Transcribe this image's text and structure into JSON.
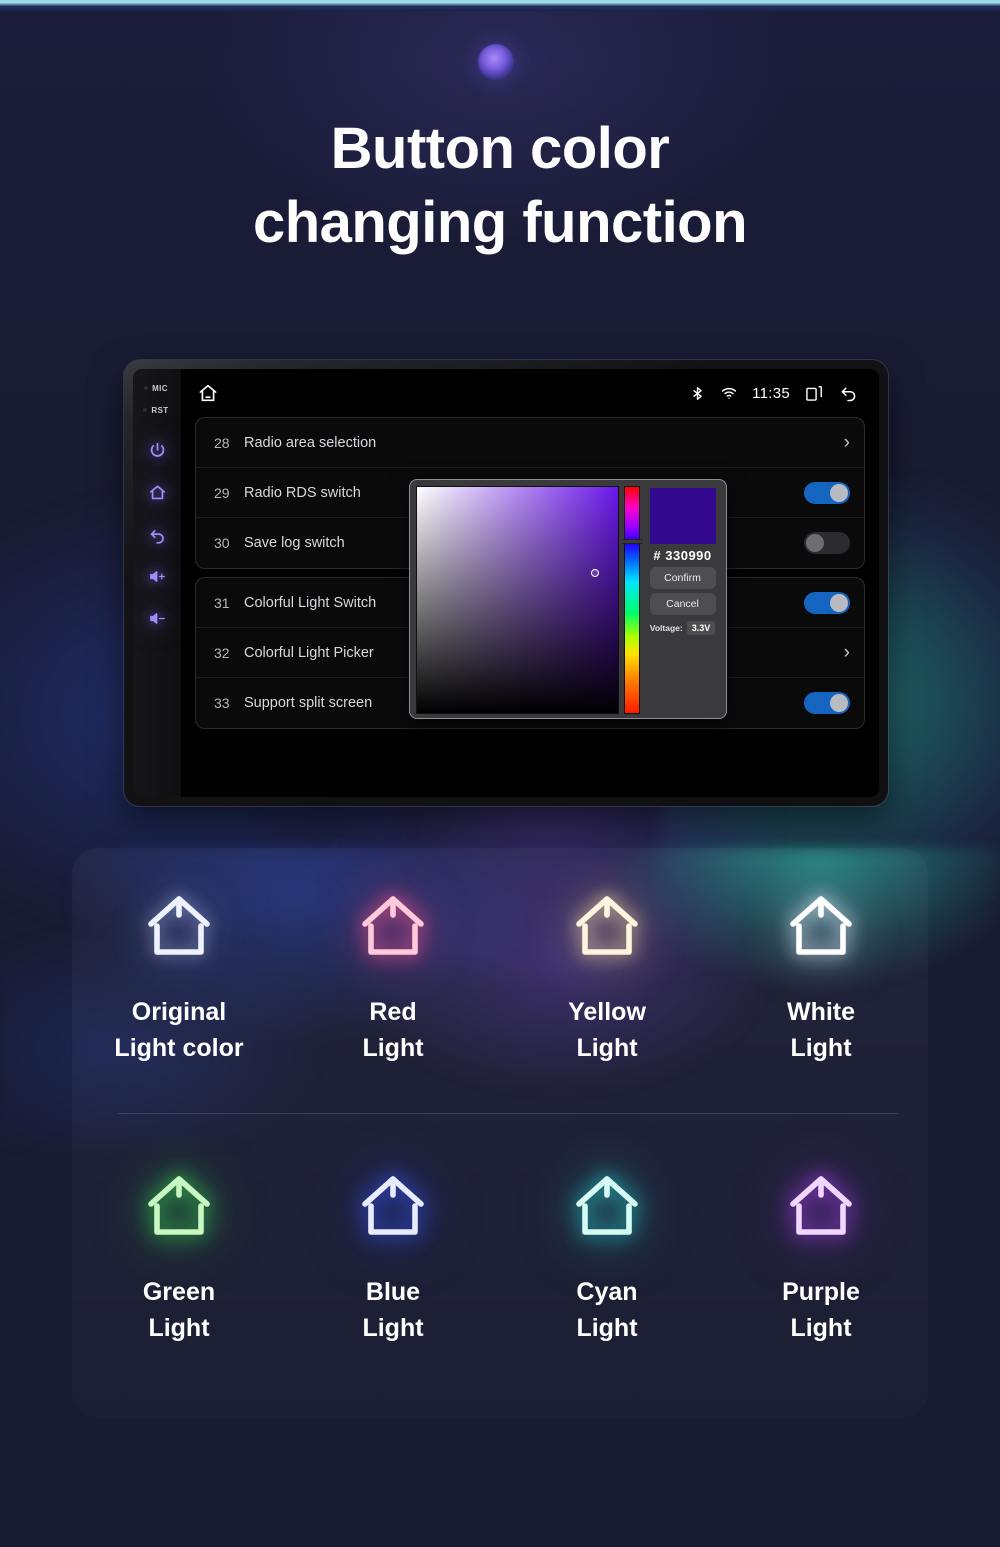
{
  "header": {
    "title_line1": "Button color",
    "title_line2": "changing function"
  },
  "device": {
    "rail": {
      "mic_label": "MIC",
      "rst_label": "RST",
      "buttons": [
        {
          "name": "power-icon"
        },
        {
          "name": "home-icon"
        },
        {
          "name": "back-icon"
        },
        {
          "name": "volume-up-icon"
        },
        {
          "name": "volume-down-icon"
        }
      ],
      "glow_color": "#a18cf5"
    },
    "statusbar": {
      "home_icon": "home-icon",
      "bluetooth_icon": "bluetooth-icon",
      "wifi_icon": "wifi-icon",
      "time": "11:35",
      "recents_icon": "recent-apps-icon",
      "back_icon": "back-icon"
    },
    "settings_groups": [
      {
        "rows": [
          {
            "num": "28",
            "label": "Radio area selection",
            "control": "chevron"
          },
          {
            "num": "29",
            "label": "Radio RDS switch",
            "control": "toggle",
            "state": "on"
          },
          {
            "num": "30",
            "label": "Save log switch",
            "control": "toggle",
            "state": "off"
          }
        ]
      },
      {
        "rows": [
          {
            "num": "31",
            "label": "Colorful Light Switch",
            "control": "toggle",
            "state": "on"
          },
          {
            "num": "32",
            "label": "Colorful Light Picker",
            "control": "chevron"
          },
          {
            "num": "33",
            "label": "Support split screen",
            "control": "toggle",
            "state": "on"
          }
        ]
      }
    ],
    "color_picker": {
      "hex_prefix": "#",
      "hex_value": "330990",
      "swatch_color": "#330990",
      "confirm_label": "Confirm",
      "cancel_label": "Cancel",
      "voltage_label": "Voltage:",
      "voltage_value": "3.3V"
    }
  },
  "lights": {
    "row1": [
      {
        "name": "original-light-color",
        "line1": "Original",
        "line2": "Light color",
        "color": "#eef2ff",
        "glow": "rgba(200,215,255,0.55)"
      },
      {
        "name": "red-light",
        "line1": "Red",
        "line2": "Light",
        "color": "#ffc9dc",
        "glow": "rgba(255,90,150,0.75)"
      },
      {
        "name": "yellow-light",
        "line1": "Yellow",
        "line2": "Light",
        "color": "#fff4dd",
        "glow": "rgba(255,225,170,0.75)"
      },
      {
        "name": "white-light",
        "line1": "White",
        "line2": "Light",
        "color": "#ffffff",
        "glow": "rgba(235,240,255,0.85)"
      }
    ],
    "row2": [
      {
        "name": "green-light",
        "line1": "Green",
        "line2": "Light",
        "color": "#c8f7c0",
        "glow": "rgba(60,235,90,0.85)"
      },
      {
        "name": "blue-light",
        "line1": "Blue",
        "line2": "Light",
        "color": "#e7ecff",
        "glow": "rgba(60,90,255,0.9)"
      },
      {
        "name": "cyan-light",
        "line1": "Cyan",
        "line2": "Light",
        "color": "#d6fbf4",
        "glow": "rgba(40,225,215,0.85)"
      },
      {
        "name": "purple-light",
        "line1": "Purple",
        "line2": "Light",
        "color": "#f0d7ff",
        "glow": "rgba(185,70,255,0.9)"
      }
    ]
  }
}
